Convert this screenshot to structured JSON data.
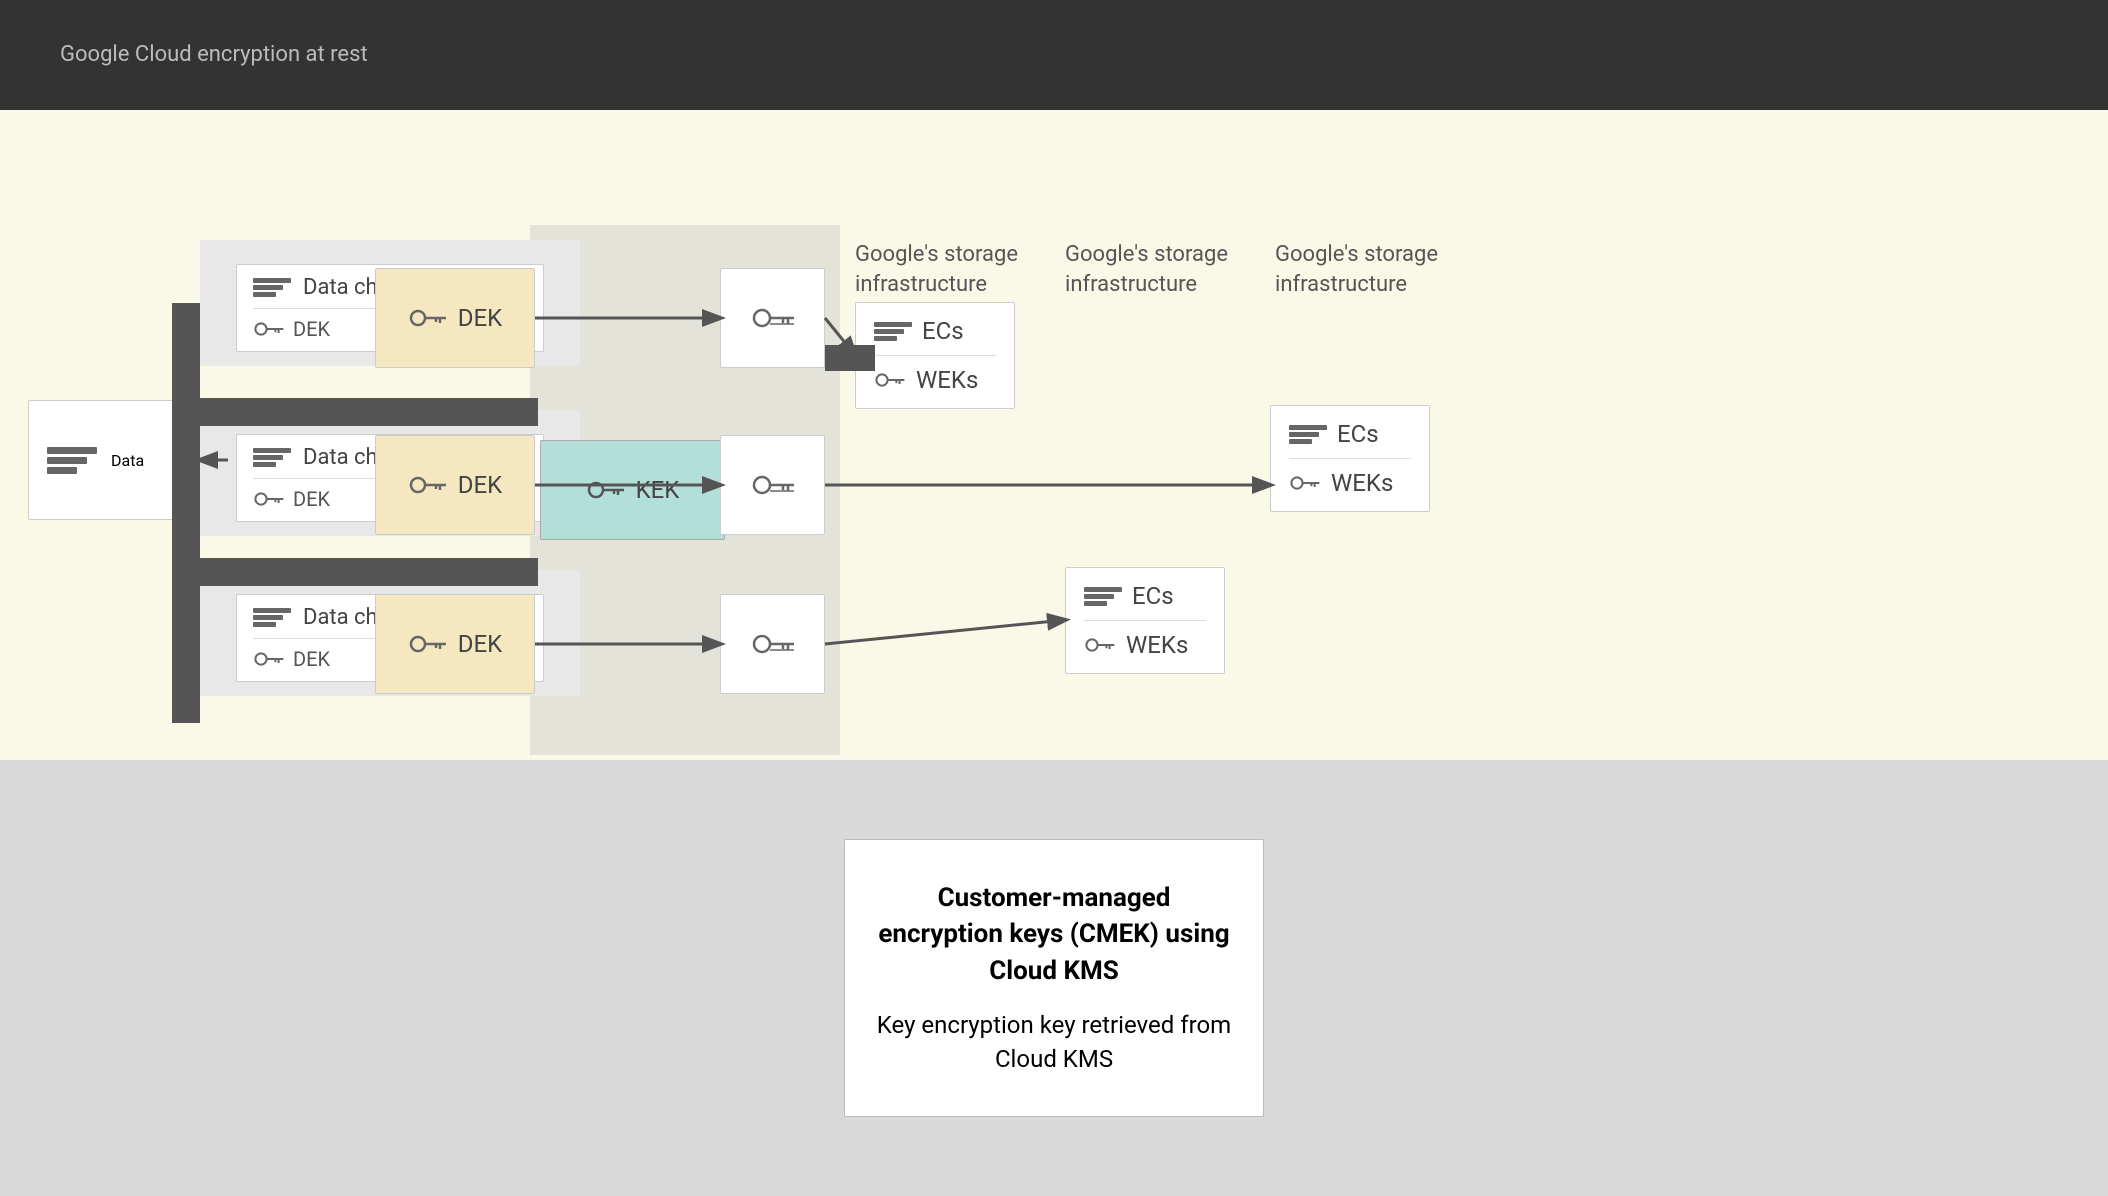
{
  "topbar": {
    "text": "Google Cloud encryption at rest"
  },
  "diagram": {
    "data_label": "Data",
    "data_chunks": [
      {
        "label": "Data chunk",
        "dek": "DEK"
      },
      {
        "label": "Data chunk",
        "dek": "DEK"
      },
      {
        "label": "Data chunk",
        "dek": "DEK"
      }
    ],
    "dek_labels": [
      "DEK",
      "DEK",
      "DEK"
    ],
    "kek_label": "KEK",
    "enc_key_symbol": "🔑",
    "storage_labels": [
      "Google's storage infrastructure",
      "Google's storage infrastructure",
      "Google's storage infrastructure"
    ],
    "storage_groups": [
      {
        "ecs": "ECs",
        "weks": "WEKs"
      },
      {
        "ecs": "ECs",
        "weks": "WEKs"
      },
      {
        "ecs": "ECs",
        "weks": "WEKs"
      }
    ]
  },
  "legend": {
    "title": "Customer-managed encryption keys (CMEK) using Cloud KMS",
    "description": "Key encryption key retrieved from Cloud KMS"
  }
}
